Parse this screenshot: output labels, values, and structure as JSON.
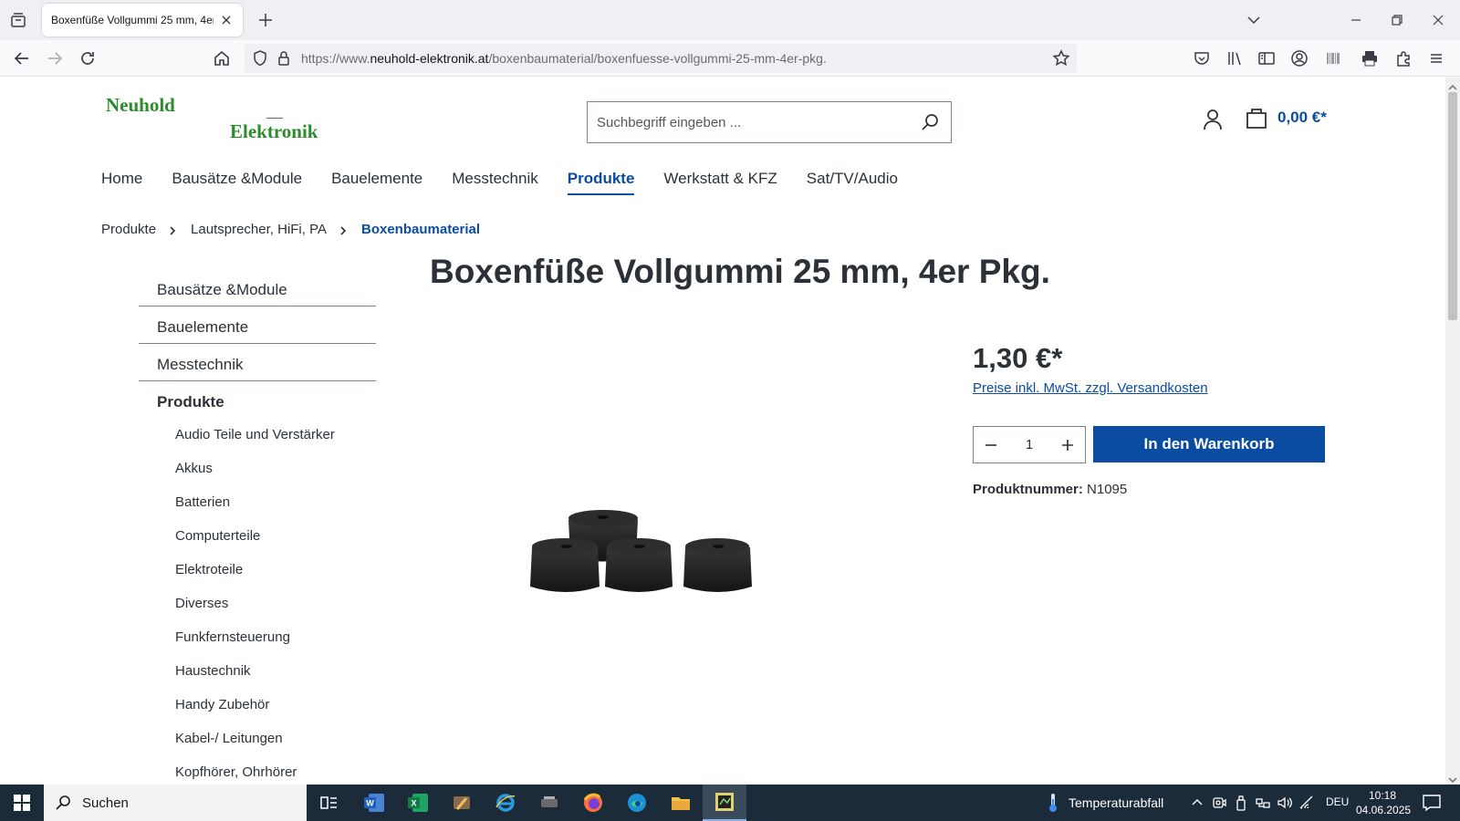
{
  "browser": {
    "tab_title": "Boxenfüße Vollgummi 25 mm, 4er P",
    "url_prefix": "https://www.",
    "url_domain": "neuhold-elektronik.at",
    "url_path": "/boxenbaumaterial/boxenfuesse-vollgummi-25-mm-4er-pkg."
  },
  "header": {
    "logo_line1": "Neuhold",
    "logo_line2": "Elektronik",
    "search_placeholder": "Suchbegriff eingeben ...",
    "cart_total": "0,00 €*"
  },
  "main_nav": [
    {
      "label": "Home"
    },
    {
      "label": "Bausätze &Module"
    },
    {
      "label": "Bauelemente"
    },
    {
      "label": "Messtechnik"
    },
    {
      "label": "Produkte"
    },
    {
      "label": "Werkstatt & KFZ"
    },
    {
      "label": "Sat/TV/Audio"
    }
  ],
  "breadcrumb": [
    "Produkte",
    "Lautsprecher, HiFi, PA",
    "Boxenbaumaterial"
  ],
  "sidebar": {
    "top_items": [
      "Bausätze &Module",
      "Bauelemente",
      "Messtechnik"
    ],
    "active_item": "Produkte",
    "sub_items": [
      "Audio Teile und Verstärker",
      "Akkus",
      "Batterien",
      "Computerteile",
      "Elektroteile",
      "Diverses",
      "Funkfernsteuerung",
      "Haustechnik",
      "Handy Zubehör",
      "Kabel-/ Leitungen",
      "Kopfhörer, Ohrhörer"
    ]
  },
  "product": {
    "title": "Boxenfüße Vollgummi 25 mm, 4er Pkg.",
    "price": "1,30 €*",
    "tax_note": "Preise inkl. MwSt. zzgl. Versandkosten",
    "quantity": "1",
    "buy_label": "In den Warenkorb",
    "number_label": "Produktnummer:",
    "number_value": "N1095"
  },
  "taskbar": {
    "search_label": "Suchen",
    "weather": "Temperaturabfall",
    "language": "DEU",
    "time": "10:18",
    "date": "04.06.2025"
  },
  "colors": {
    "brand_blue": "#0b4ca3",
    "logo_green": "#2a8c2a",
    "taskbar": "#1c2b3a"
  }
}
